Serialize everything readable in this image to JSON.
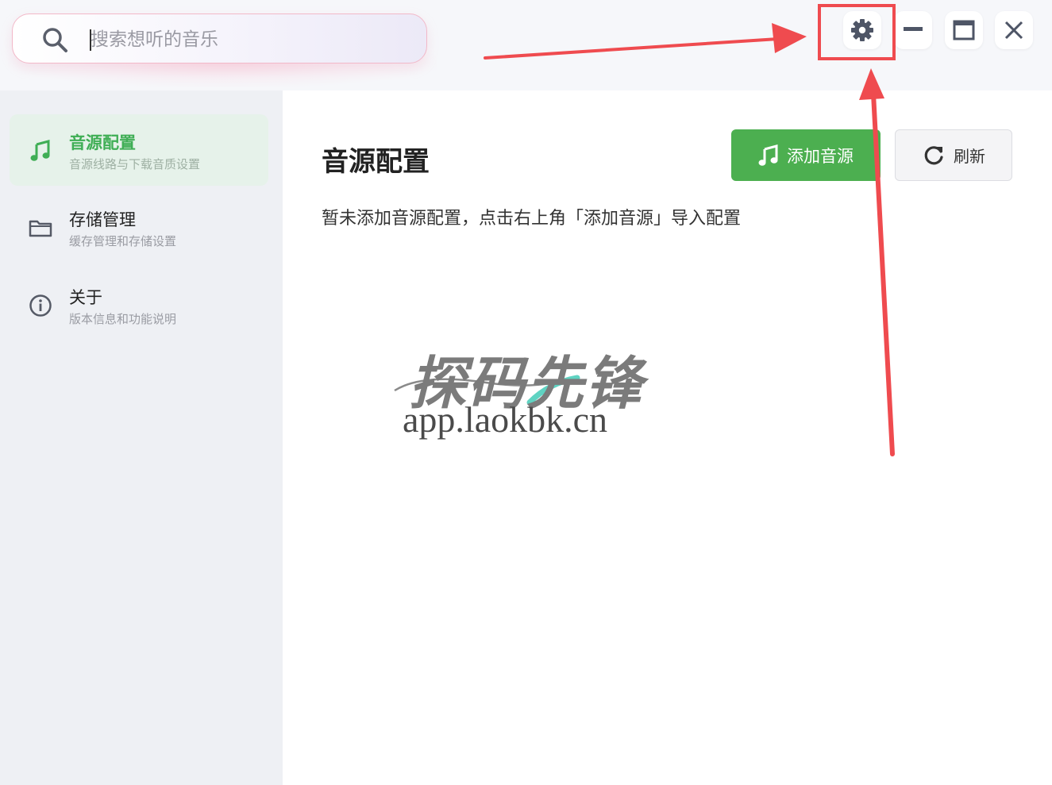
{
  "search": {
    "placeholder": "搜索想听的音乐",
    "icon": "search-icon"
  },
  "window_controls": {
    "settings_icon": "gear-icon",
    "minimize_icon": "minimize-icon",
    "maximize_icon": "maximize-icon",
    "close_icon": "close-icon"
  },
  "sidebar": {
    "items": [
      {
        "title": "音源配置",
        "subtitle": "音源线路与下载音质设置",
        "icon": "music-note-icon",
        "active": true
      },
      {
        "title": "存储管理",
        "subtitle": "缓存管理和存储设置",
        "icon": "folder-icon",
        "active": false
      },
      {
        "title": "关于",
        "subtitle": "版本信息和功能说明",
        "icon": "info-icon",
        "active": false
      }
    ]
  },
  "main": {
    "title": "音源配置",
    "add_button": "添加音源",
    "refresh_button": "刷新",
    "empty_message": "暂未添加音源配置，点击右上角「添加音源」导入配置"
  },
  "watermark": {
    "brand": "探码先锋",
    "url": "app.laokbk.cn"
  },
  "colors": {
    "accent_green": "#4caf50",
    "annotation_red": "#ef4b4f",
    "active_item_bg": "#e6f2ea"
  }
}
